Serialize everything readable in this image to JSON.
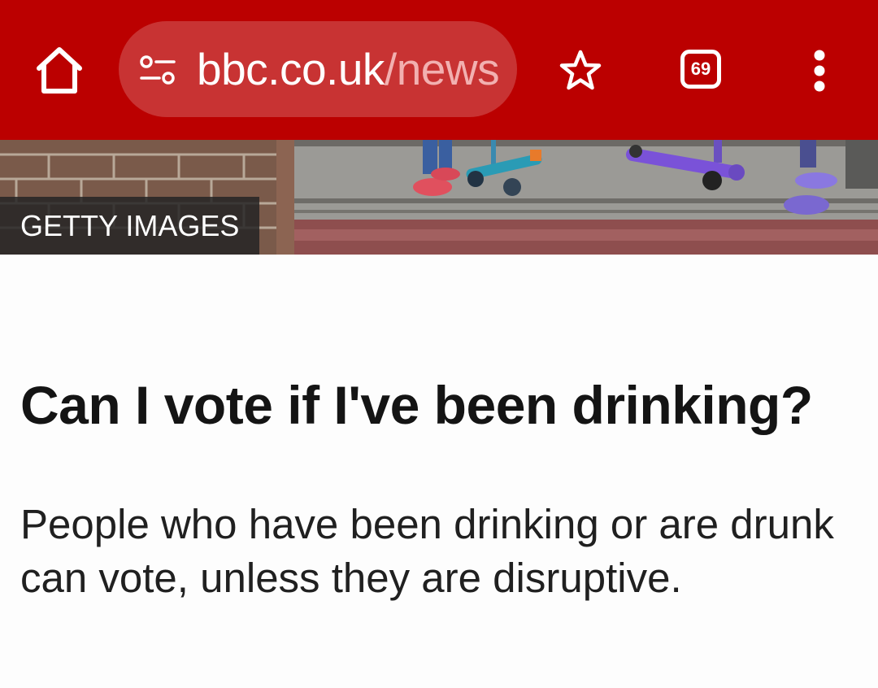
{
  "browser": {
    "url_domain": "bbc.co.uk",
    "url_path": "/news",
    "tab_count": "69",
    "colors": {
      "toolbar": "#bb0000",
      "url_pill": "#c83333",
      "url_path": "#f2b0b0"
    },
    "icons": {
      "home": "home-icon",
      "site_settings": "site-settings-icon",
      "bookmark": "star-icon",
      "tabs": "tab-switcher-icon",
      "menu": "more-vert-icon"
    }
  },
  "hero": {
    "image_alt": "Children's feet and scooters on a pavement",
    "credit": "GETTY IMAGES"
  },
  "article": {
    "headline": "Can I vote if I've been drinking?",
    "summary": "People who have been drinking or are drunk can vote, unless they are disruptive."
  }
}
